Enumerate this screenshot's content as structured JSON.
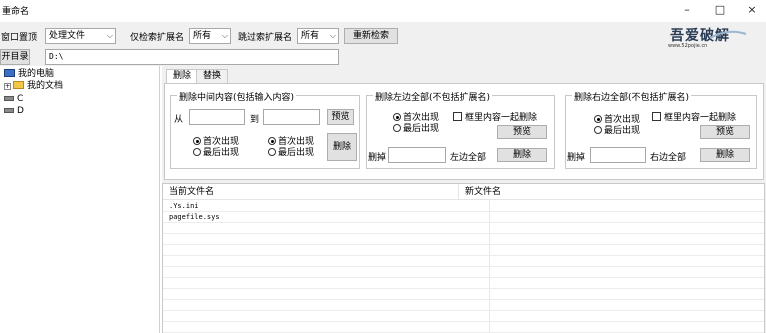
{
  "window": {
    "title": "重命名",
    "min": "–",
    "max": "□",
    "close": "×"
  },
  "toolbar": {
    "window_topmost_label": "窗口置顶",
    "action_value": "处理文件",
    "only_ext_label": "仅检索扩展名",
    "only_ext_value": "所有",
    "skip_ext_label": "跳过索扩展名",
    "skip_ext_value": "所有",
    "research_button": "重新检索",
    "open_dir_button": "开目录",
    "path_value": "D:\\"
  },
  "logo": {
    "text": "吾爱破解",
    "sub": "www.52pojie.cn"
  },
  "tree": {
    "root": "我的电脑",
    "docs": "我的文档",
    "drive_c": "C",
    "drive_d": "D"
  },
  "tabs": [
    {
      "label": "删除"
    },
    {
      "label": "替换"
    }
  ],
  "middle": {
    "title": "删除中间内容(包括输入内容)",
    "from_label": "从",
    "to_label": "到",
    "from_value": "",
    "to_value": "",
    "preview_button": "预览",
    "first_label": "首次出现",
    "last_label": "最后出现",
    "delete_button": "删除"
  },
  "left_all": {
    "title": "删除左边全部(不包括扩展名)",
    "first_label": "首次出现",
    "last_label": "最后出现",
    "with_box_label": "框里内容一起删除",
    "preview_button": "预览",
    "delete_label": "删掉",
    "value": "",
    "suffix_label": "左边全部",
    "delete_button": "删除"
  },
  "right_all": {
    "title": "删除右边全部(不包括扩展名)",
    "first_label": "首次出现",
    "last_label": "最后出现",
    "with_box_label": "框里内容一起删除",
    "preview_button": "预览",
    "delete_label": "删掉",
    "value": "",
    "suffix_label": "右边全部",
    "delete_button": "删除"
  },
  "list": {
    "columns": [
      "当前文件名",
      "新文件名"
    ],
    "rows": [
      {
        "current": ".Ys.ini",
        "new": ""
      },
      {
        "current": "pagefile.sys",
        "new": ""
      }
    ]
  }
}
